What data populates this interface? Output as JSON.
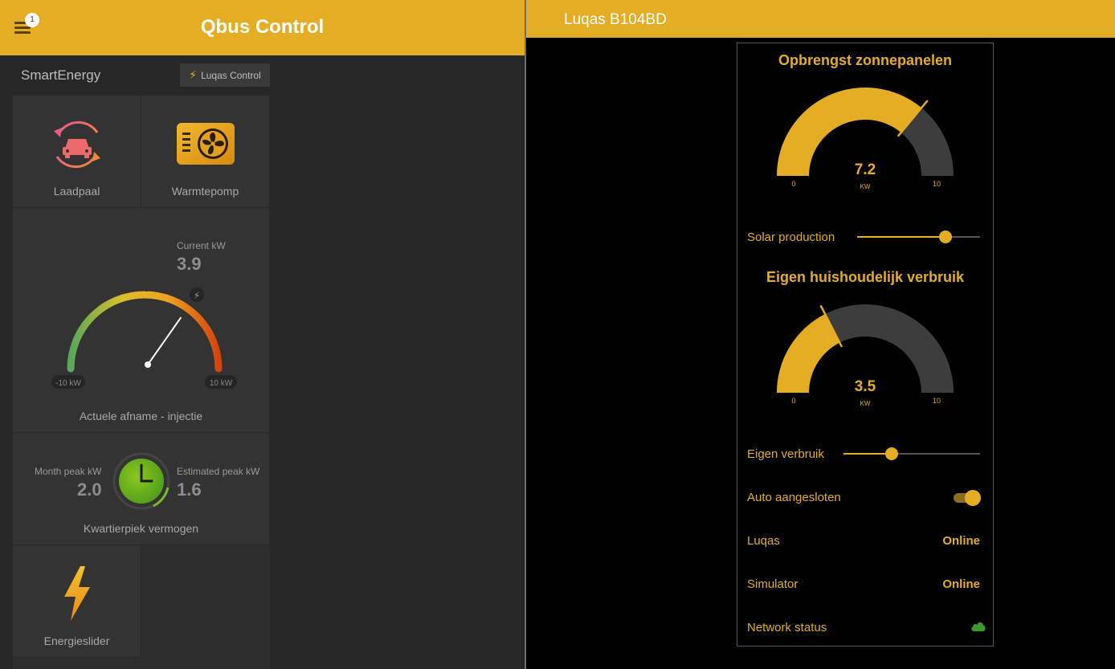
{
  "left": {
    "menu_badge": "1",
    "title": "Qbus Control",
    "section_title": "SmartEnergy",
    "luqas_button": "Luqas Control",
    "tiles": {
      "laadpaal": "Laadpaal",
      "warmtepomp": "Warmtepomp",
      "energieslider": "Energieslider"
    },
    "power_gauge": {
      "current_label": "Current kW",
      "current_value": "3.9",
      "min_label": "-10 kW",
      "max_label": "10 kW",
      "min": -10,
      "max": 10,
      "value": 3.9,
      "caption": "Actuele afname - injectie"
    },
    "peak": {
      "month_label": "Month peak kW",
      "month_value": "2.0",
      "estimated_label": "Estimated peak kW",
      "estimated_value": "1.6",
      "caption": "Kwartierpiek vermogen"
    }
  },
  "right": {
    "title": "Luqas B104BD",
    "solar_gauge": {
      "title": "Opbrengst zonnepanelen",
      "value": 7.2,
      "value_text": "7.2",
      "unit": "KW",
      "min": 0,
      "max": 10,
      "min_text": "0",
      "max_text": "10"
    },
    "solar_slider": {
      "label": "Solar production",
      "fraction": 0.72
    },
    "house_gauge": {
      "title": "Eigen huishoudelijk verbruik",
      "value": 3.5,
      "value_text": "3.5",
      "unit": "KW",
      "min": 0,
      "max": 10,
      "min_text": "0",
      "max_text": "10"
    },
    "house_slider": {
      "label": "Eigen verbruik",
      "fraction": 0.35
    },
    "auto": {
      "label": "Auto aangesloten",
      "on": true
    },
    "luqas_status": {
      "label": "Luqas",
      "value": "Online"
    },
    "simulator_status": {
      "label": "Simulator",
      "value": "Online"
    },
    "network": {
      "label": "Network status",
      "icon": "cloud-icon",
      "color": "#3a9a2a"
    }
  },
  "colors": {
    "accent": "#e4ad24",
    "bg": "#000000",
    "panel": "#272727"
  }
}
